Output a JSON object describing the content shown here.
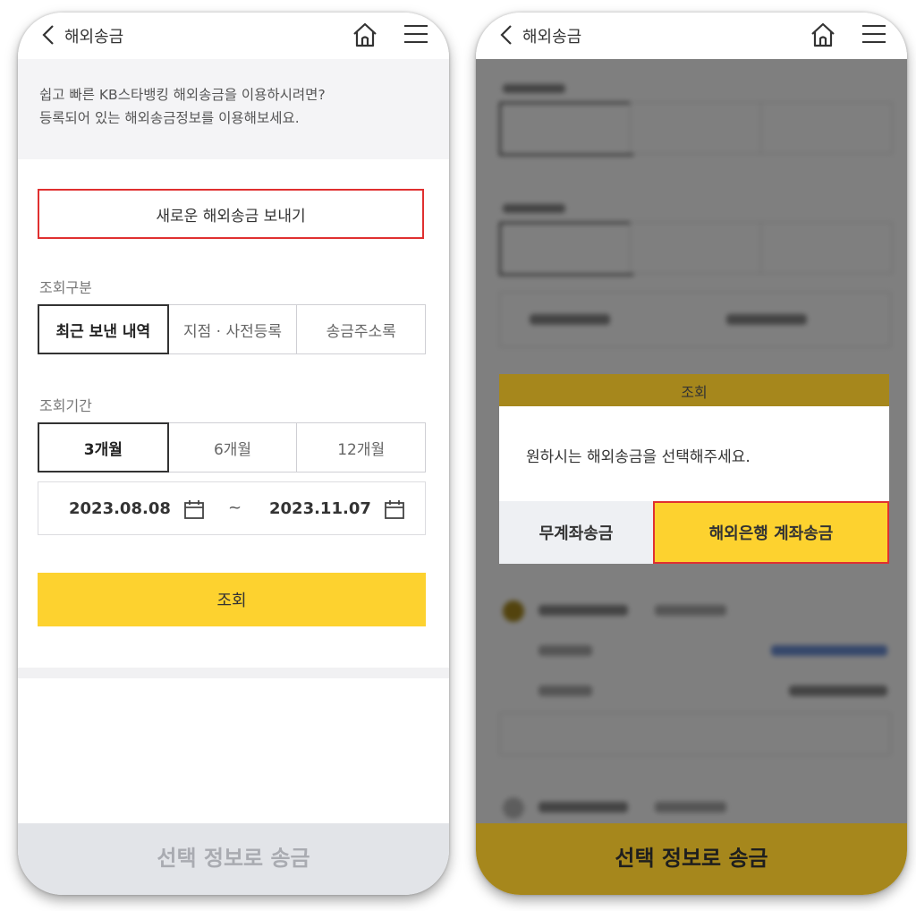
{
  "left_screen": {
    "nav": {
      "title": "해외송금",
      "back_icon": "chevron-left-icon",
      "home_icon": "home-icon",
      "menu_icon": "hamburger-menu-icon"
    },
    "notice": {
      "line1": "쉽고 빠른 KB스타뱅킹 해외송금을 이용하시려면?",
      "line2": "등록되어 있는 해외송금정보를 이용해보세요."
    },
    "new_transfer_button": "새로운 해외송금 보내기",
    "query_type": {
      "label": "조회구분",
      "options": [
        "최근 보낸 내역",
        "지점 · 사전등록",
        "송금주소록"
      ],
      "selected": "최근 보낸 내역"
    },
    "query_period": {
      "label": "조회기간",
      "options": [
        "3개월",
        "6개월",
        "12개월"
      ],
      "selected": "3개월"
    },
    "date_range": {
      "start": "2023.08.08",
      "separator": "~",
      "end": "2023.11.07"
    },
    "search_button": "조회",
    "bottom_button": "선택 정보로 송금"
  },
  "right_screen": {
    "nav": {
      "title": "해외송금"
    },
    "modal_header": "조회",
    "modal": {
      "message": "원하시는 해외송금을 선택해주세요.",
      "option_no_account": "무계좌송금",
      "option_overseas_bank": "해외은행 계좌송금"
    },
    "bottom_button": "선택 정보로 송금"
  },
  "colors": {
    "accent_yellow": "#fdd22f",
    "dimmed_yellow": "#a6871c",
    "highlight_red": "#e03030"
  }
}
